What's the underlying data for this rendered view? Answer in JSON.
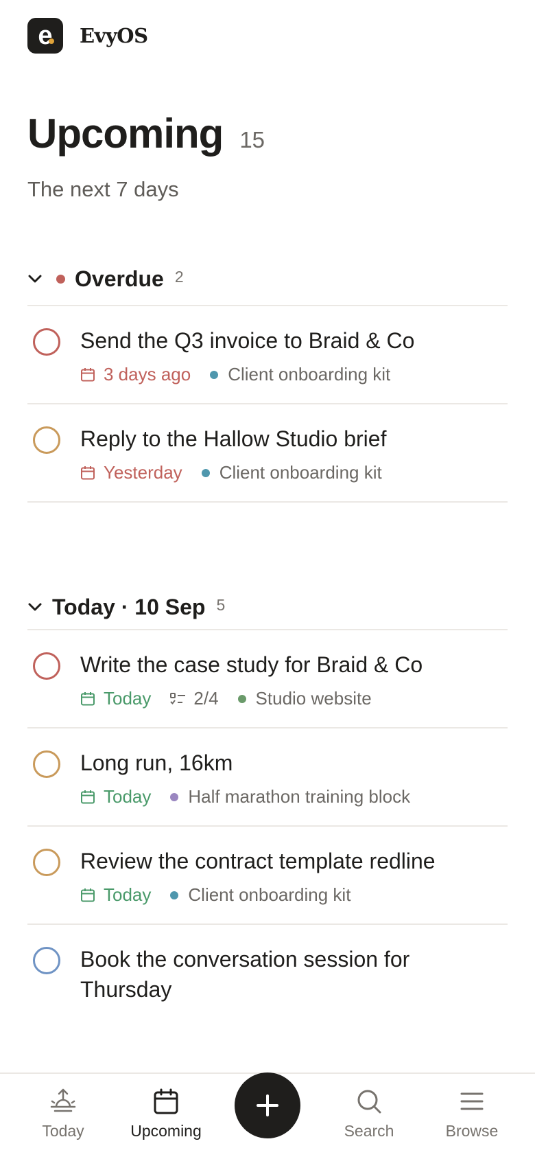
{
  "app": {
    "name": "EvyOS",
    "logo_letter": "e"
  },
  "page": {
    "title": "Upcoming",
    "count": "15",
    "subtitle": "The next 7 days"
  },
  "colors": {
    "overdue_red": "#c0615b",
    "today_green": "#4a9a6a",
    "priority_red": "#c0615b",
    "priority_orange": "#c99a5b",
    "priority_blue": "#6f93c4",
    "project_teal": "#4f97ad",
    "project_green": "#6a9a6a",
    "project_purple": "#9a86c0"
  },
  "sections": [
    {
      "title": "Overdue",
      "count": "2",
      "tasks": [
        {
          "name": "Send the Q3 invoice to Braid & Co",
          "due": "3 days ago",
          "project": "Client onboarding kit",
          "priority": "red"
        },
        {
          "name": "Reply to the Hallow Studio brief",
          "due": "Yesterday",
          "project": "Client onboarding kit",
          "priority": "orange"
        }
      ]
    },
    {
      "title": "Today · 10 Sep",
      "count": "5",
      "tasks": [
        {
          "name": "Write the case study for Braid & Co",
          "due": "Today",
          "subtasks": "2/4",
          "project": "Studio website",
          "priority": "red"
        },
        {
          "name": "Long run, 16km",
          "due": "Today",
          "project": "Half marathon training block",
          "priority": "orange"
        },
        {
          "name": "Review the contract template redline",
          "due": "Today",
          "project": "Client onboarding kit",
          "priority": "orange"
        },
        {
          "name": "Book the conversation session for Thursday",
          "priority": "blue"
        }
      ]
    }
  ],
  "tabbar": {
    "today": "Today",
    "upcoming": "Upcoming",
    "search": "Search",
    "browse": "Browse",
    "add_icon": "plus-icon"
  }
}
